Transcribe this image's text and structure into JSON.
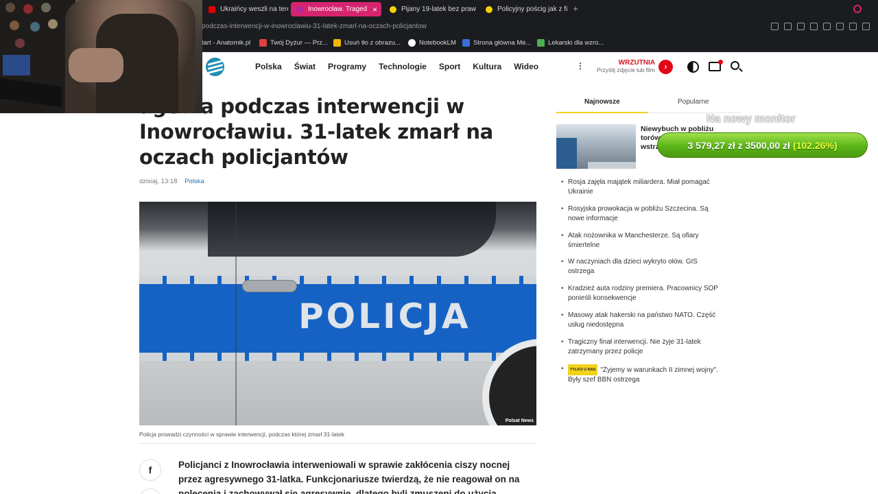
{
  "browser": {
    "tabs": [
      {
        "label": "Ukraińcy weszli na teren",
        "fav_color": "#e00000",
        "active": false
      },
      {
        "label": "Inowrocław. Traged",
        "fav_color": "#b02aa0",
        "active": true
      },
      {
        "label": "Pijany 19-latek bez praw",
        "fav_color": "#f5d400",
        "active": false
      },
      {
        "label": "Policyjny pościg jak z film",
        "fav_color": "#f5d400",
        "active": false
      }
    ],
    "new_tab": "+",
    "tab_close": "×",
    "url": "podczas-interwencji-w-inowroclawiu-31-latek-zmarl-na-oczach-policjantow",
    "bookmarks": [
      {
        "label": "tart - Anatomik.pl",
        "fav_color": "#1b1c20"
      },
      {
        "label": "Twój Dyżur — Prz...",
        "fav_color": "#e04040"
      },
      {
        "label": "Usuń tło z obrazu...",
        "fav_color": "#f2b705"
      },
      {
        "label": "NotebookLM",
        "fav_color": "#ffffff"
      },
      {
        "label": "Strona główna Me...",
        "fav_color": "#3a6fd8"
      },
      {
        "label": "Lekarski dla wzro...",
        "fav_color": "#4caf50"
      }
    ]
  },
  "header": {
    "nav": [
      "Polska",
      "Świat",
      "Programy",
      "Technologie",
      "Sport",
      "Kultura",
      "Wideo"
    ],
    "more": "⋮",
    "wrzutnia_title": "WRZUTNIA",
    "wrzutnia_subtitle": "Przyślij zdjęcie lub film",
    "wrzutnia_arrow": "›"
  },
  "article": {
    "headline": "agedia podczas interwencji w Inowrocławiu. 31-latek zmarł na oczach policjantów",
    "date": "dzisiaj, 13:18",
    "category": "Polska",
    "photo_text": "POLICJA",
    "photo_credit": "Polsat News",
    "caption": "Policja prowadzi czynności w sprawie interwencji, podczas której zmarł 31-latek",
    "share_fb": "f",
    "lead": "Policjanci z Inowrocławia interweniowali w sprawie zakłócenia ciszy nocnej przez agresywnego 31-latka. Funkcjonariusze twierdzą, że nie reagował on na polecenia i zachowywał się agresywnie, dlatego byli zmuszeni do użycia"
  },
  "sidebar": {
    "tabs": [
      "Najnowsze",
      "Popularne"
    ],
    "featured": "Niewybuch w pobliżu torów. Ruch pociągów wstrzymany",
    "items": [
      {
        "badge": "",
        "text": "Rosja zajęła majątek miliardera. Miał pomagać Ukrainie"
      },
      {
        "badge": "",
        "text": "Rosyjska prowokacja w pobliżu Szczecina. Są nowe informacje"
      },
      {
        "badge": "",
        "text": "Atak nożownika w Manchesterze. Są ofiary śmiertelne"
      },
      {
        "badge": "",
        "text": "W naczyniach dla dzieci wykryto ołów. GIS ostrzega"
      },
      {
        "badge": "",
        "text": "Kradzież auta rodziny premiera. Pracownicy SOP ponieśli konsekwencje"
      },
      {
        "badge": "",
        "text": "Masowy atak hakerski na państwo NATO. Część usług niedostępna"
      },
      {
        "badge": "",
        "text": "Tragiczny finał interwencji. Nie żyje 31-latek zatrzymany przez policje"
      },
      {
        "badge": "TYLKO U NAS",
        "text": "\"Żyjemy w warunkach II zimnej wojny\". Były szef BBN ostrzega"
      }
    ]
  },
  "overlay": {
    "monitor_label": "Na nowy monitor",
    "goal_text": "3 579,27 zł z 3500,00 zł",
    "goal_percent": "(102.26%)",
    "goal_progress": 1.0226
  },
  "colors": {
    "accent_tab": "#d6246e",
    "brand_red": "#e30613",
    "highlight_yellow": "#f2d21b",
    "link_blue": "#1e6fb3"
  }
}
